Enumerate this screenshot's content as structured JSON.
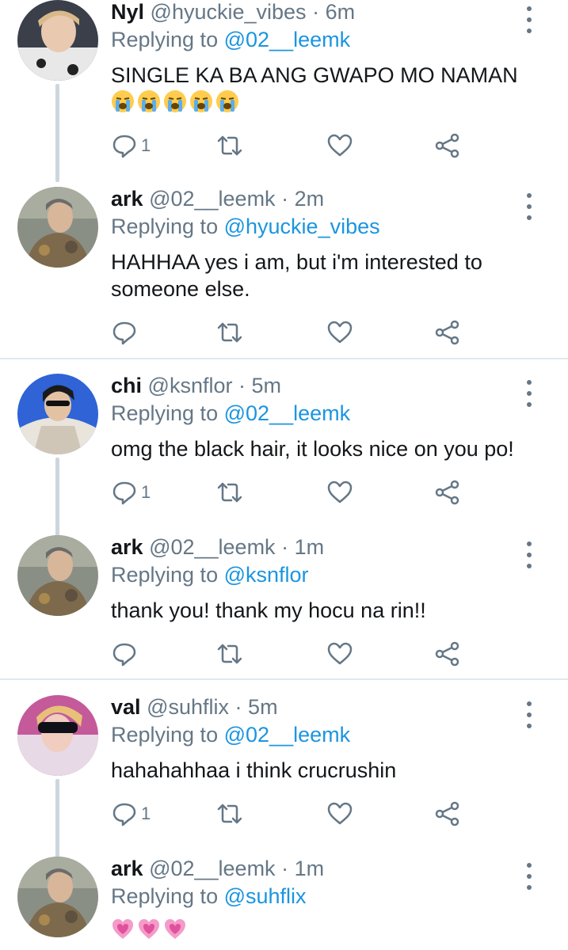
{
  "tweets": [
    {
      "name": "Nyl",
      "handle": "@hyuckie_vibes",
      "separator": "·",
      "time": "6m",
      "replying_prefix": "Replying to",
      "replying_to": "@02__leemk",
      "text": "SINGLE KA BA ANG GWAPO MO NAMAN",
      "emoji": [
        "loudly-crying-face",
        "loudly-crying-face",
        "loudly-crying-face",
        "loudly-crying-face",
        "loudly-crying-face"
      ],
      "reply_count": "1"
    },
    {
      "name": "ark",
      "handle": "@02__leemk",
      "separator": "·",
      "time": "2m",
      "replying_prefix": "Replying to",
      "replying_to": "@hyuckie_vibes",
      "text": "HAHHAA yes i am, but i'm interested to someone else.",
      "emoji": [],
      "reply_count": ""
    },
    {
      "name": "chi",
      "handle": "@ksnflor",
      "separator": "·",
      "time": "5m",
      "replying_prefix": "Replying to",
      "replying_to": "@02__leemk",
      "text": "omg the black hair, it looks nice on you po!",
      "emoji": [],
      "reply_count": "1"
    },
    {
      "name": "ark",
      "handle": "@02__leemk",
      "separator": "·",
      "time": "1m",
      "replying_prefix": "Replying to",
      "replying_to": "@ksnflor",
      "text": "thank you! thank my hocu na rin!!",
      "emoji": [],
      "reply_count": ""
    },
    {
      "name": "val",
      "handle": "@suhflix",
      "separator": "·",
      "time": "5m",
      "replying_prefix": "Replying to",
      "replying_to": "@02__leemk",
      "text": "hahahahhaa i think crucrushin",
      "emoji": [],
      "reply_count": "1"
    },
    {
      "name": "ark",
      "handle": "@02__leemk",
      "separator": "·",
      "time": "1m",
      "replying_prefix": "Replying to",
      "replying_to": "@suhflix",
      "text": "",
      "emoji": [
        "growing-heart",
        "growing-heart",
        "growing-heart"
      ],
      "reply_count": ""
    }
  ],
  "colors": {
    "text": "#14171a",
    "muted": "#657786",
    "link": "#1b95e0",
    "thread": "#ccd6dd",
    "divider": "#e1e8ed"
  }
}
